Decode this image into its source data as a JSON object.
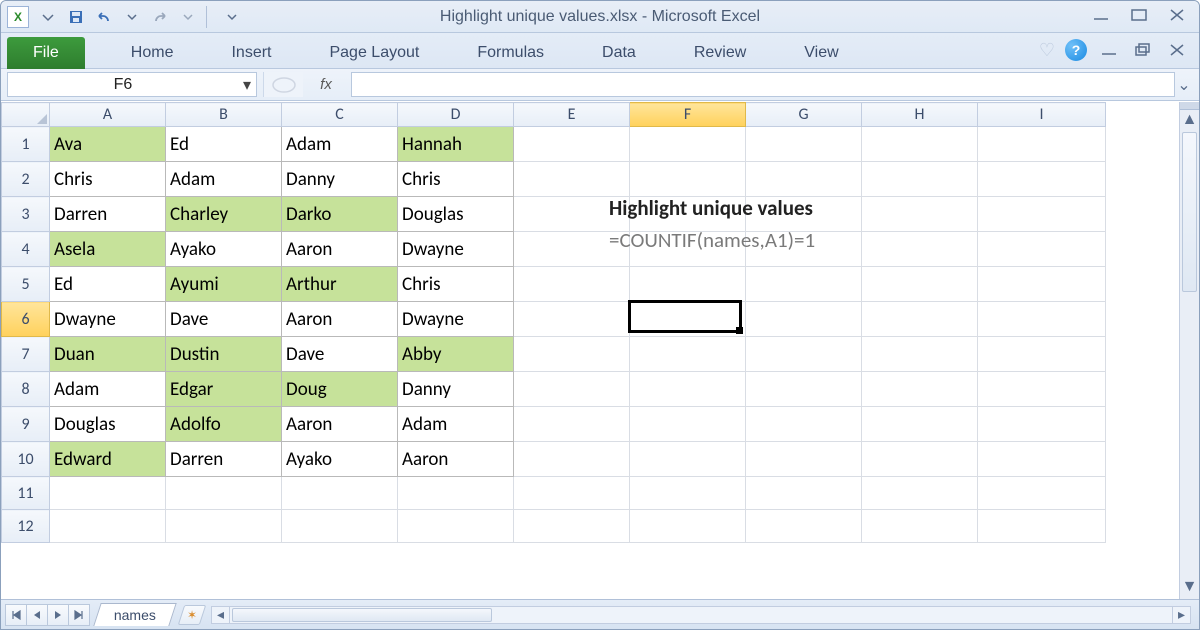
{
  "window": {
    "title": "Highlight unique values.xlsx  -  Microsoft Excel"
  },
  "ribbon": {
    "file": "File",
    "tabs": [
      "Home",
      "Insert",
      "Page Layout",
      "Formulas",
      "Data",
      "Review",
      "View"
    ]
  },
  "namebox": "F6",
  "fx_label": "fx",
  "formula": "",
  "columns": [
    "A",
    "B",
    "C",
    "D",
    "E",
    "F",
    "G",
    "H",
    "I"
  ],
  "rows": [
    1,
    2,
    3,
    4,
    5,
    6,
    7,
    8,
    9,
    10,
    11,
    12
  ],
  "active": {
    "col": "F",
    "row": 6
  },
  "data": {
    "A": [
      "Ava",
      "Chris",
      "Darren",
      "Asela",
      "Ed",
      "Dwayne",
      "Duan",
      "Adam",
      "Douglas",
      "Edward"
    ],
    "B": [
      "Ed",
      "Adam",
      "Charley",
      "Ayako",
      "Ayumi",
      "Dave",
      "Dustin",
      "Edgar",
      "Adolfo",
      "Darren"
    ],
    "C": [
      "Adam",
      "Danny",
      "Darko",
      "Aaron",
      "Arthur",
      "Aaron",
      "Dave",
      "Doug",
      "Aaron",
      "Ayako"
    ],
    "D": [
      "Hannah",
      "Chris",
      "Douglas",
      "Dwayne",
      "Chris",
      "Dwayne",
      "Abby",
      "Danny",
      "Adam",
      "Aaron"
    ]
  },
  "highlight": [
    "A1",
    "A4",
    "A7",
    "A10",
    "B3",
    "B5",
    "B7",
    "B8",
    "B9",
    "C3",
    "C5",
    "C8",
    "D1",
    "D7"
  ],
  "overlay": {
    "title": "Highlight unique values",
    "formula": "=COUNTIF(names,A1)=1"
  },
  "sheet_tab": "names"
}
